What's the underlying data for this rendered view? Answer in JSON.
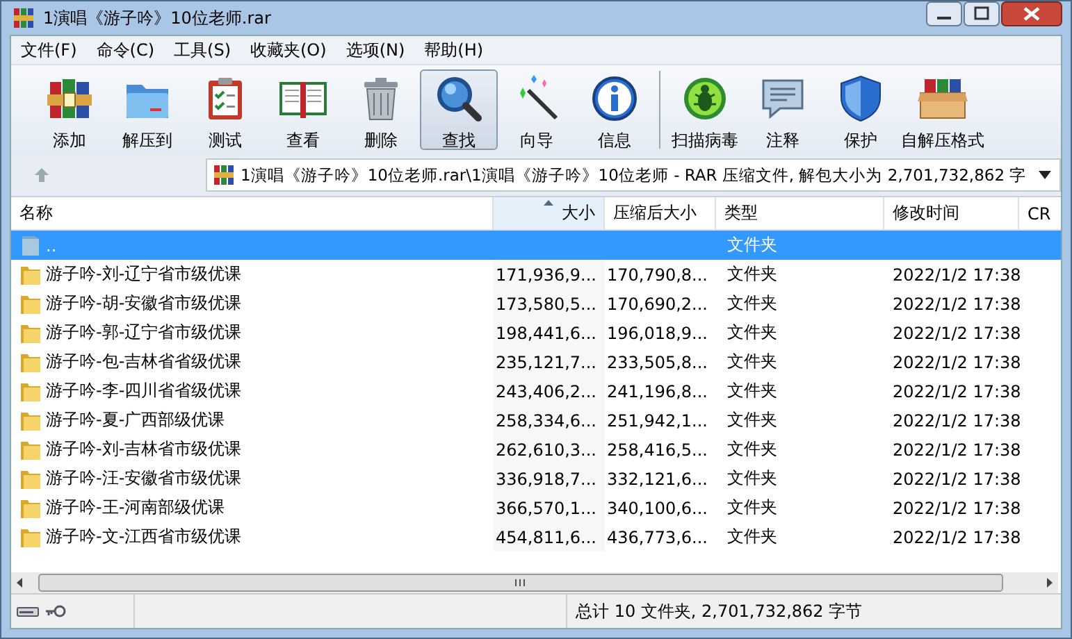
{
  "window": {
    "title": "1演唱《游子吟》10位老师.rar"
  },
  "menu": [
    {
      "label": "文件(F)"
    },
    {
      "label": "命令(C)"
    },
    {
      "label": "工具(S)"
    },
    {
      "label": "收藏夹(O)"
    },
    {
      "label": "选项(N)"
    },
    {
      "label": "帮助(H)"
    }
  ],
  "toolbar": {
    "groups": [
      [
        {
          "label": "添加",
          "selected": false
        },
        {
          "label": "解压到",
          "selected": false
        },
        {
          "label": "测试",
          "selected": false
        },
        {
          "label": "查看",
          "selected": false
        },
        {
          "label": "删除",
          "selected": false
        },
        {
          "label": "查找",
          "selected": true
        },
        {
          "label": "向导",
          "selected": false
        },
        {
          "label": "信息",
          "selected": false
        }
      ],
      [
        {
          "label": "扫描病毒",
          "selected": false
        },
        {
          "label": "注释",
          "selected": false
        },
        {
          "label": "保护",
          "selected": false
        },
        {
          "label": "自解压格式",
          "selected": false
        }
      ]
    ]
  },
  "address": {
    "path": "1演唱《游子吟》10位老师.rar\\1演唱《游子吟》10位老师 - RAR 压缩文件, 解包大小为 2,701,732,862 字"
  },
  "table": {
    "columns": [
      {
        "label": "名称",
        "sorted": false
      },
      {
        "label": "大小",
        "sorted": true
      },
      {
        "label": "压缩后大小",
        "sorted": false
      },
      {
        "label": "类型",
        "sorted": false
      },
      {
        "label": "修改时间",
        "sorted": false
      },
      {
        "label": "CR",
        "sorted": false
      }
    ],
    "rows": [
      {
        "kind": "parent",
        "name": "..",
        "size": "",
        "packed": "",
        "type": "文件夹",
        "modified": "",
        "selected": true
      },
      {
        "kind": "folder",
        "name": "游子吟-刘-辽宁省市级优课",
        "size": "171,936,9...",
        "packed": "170,790,8...",
        "type": "文件夹",
        "modified": "2022/1/2 17:38",
        "selected": false
      },
      {
        "kind": "folder",
        "name": "游子吟-胡-安徽省市级优课",
        "size": "173,580,5...",
        "packed": "170,690,2...",
        "type": "文件夹",
        "modified": "2022/1/2 17:38",
        "selected": false
      },
      {
        "kind": "folder",
        "name": "游子吟-郭-辽宁省市级优课",
        "size": "198,441,6...",
        "packed": "196,018,9...",
        "type": "文件夹",
        "modified": "2022/1/2 17:38",
        "selected": false
      },
      {
        "kind": "folder",
        "name": "游子吟-包-吉林省省级优课",
        "size": "235,121,7...",
        "packed": "233,505,8...",
        "type": "文件夹",
        "modified": "2022/1/2 17:38",
        "selected": false
      },
      {
        "kind": "folder",
        "name": "游子吟-李-四川省省级优课",
        "size": "243,406,2...",
        "packed": "241,196,8...",
        "type": "文件夹",
        "modified": "2022/1/2 17:38",
        "selected": false
      },
      {
        "kind": "folder",
        "name": "游子吟-夏-广西部级优课",
        "size": "258,334,6...",
        "packed": "251,942,1...",
        "type": "文件夹",
        "modified": "2022/1/2 17:38",
        "selected": false
      },
      {
        "kind": "folder",
        "name": "游子吟-刘-吉林省市级优课",
        "size": "262,610,3...",
        "packed": "258,416,5...",
        "type": "文件夹",
        "modified": "2022/1/2 17:38",
        "selected": false
      },
      {
        "kind": "folder",
        "name": "游子吟-汪-安徽省市级优课",
        "size": "336,918,7...",
        "packed": "332,121,6...",
        "type": "文件夹",
        "modified": "2022/1/2 17:38",
        "selected": false
      },
      {
        "kind": "folder",
        "name": "游子吟-王-河南部级优课",
        "size": "366,570,1...",
        "packed": "340,100,6...",
        "type": "文件夹",
        "modified": "2022/1/2 17:38",
        "selected": false
      },
      {
        "kind": "folder",
        "name": "游子吟-文-江西省市级优课",
        "size": "454,811,6...",
        "packed": "436,773,6...",
        "type": "文件夹",
        "modified": "2022/1/2 17:38",
        "selected": false
      }
    ]
  },
  "status_bar": {
    "summary": "总计 10 文件夹, 2,701,732,862 字节"
  }
}
